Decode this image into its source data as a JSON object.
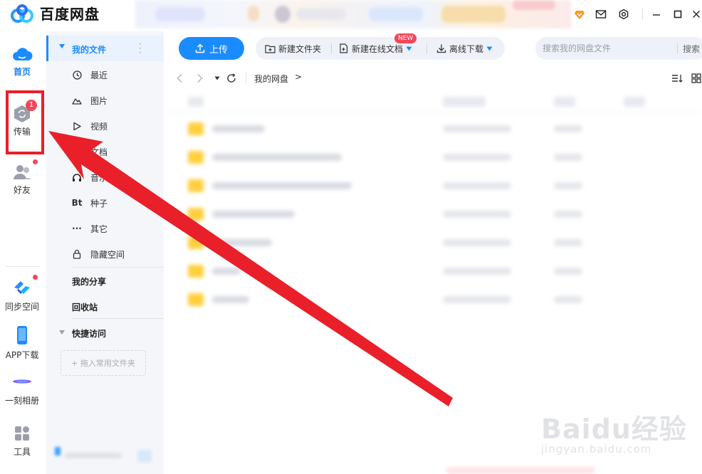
{
  "titlebar": {
    "title": "百度网盘",
    "icons": [
      "app-logo-icon",
      "vip-icon",
      "mail-icon",
      "settings-icon",
      "minimize-icon",
      "maximize-icon",
      "close-icon"
    ]
  },
  "rail": {
    "home": "首页",
    "transfer": "传输",
    "transfer_badge": "1",
    "friends": "好友",
    "sync": "同步空间",
    "app_download": "APP下载",
    "album": "一刻相册",
    "tools": "工具"
  },
  "sidebar": {
    "my_files": "我的文件",
    "items": [
      {
        "label": "最近",
        "icon": "clock-icon"
      },
      {
        "label": "图片",
        "icon": "image-icon"
      },
      {
        "label": "视频",
        "icon": "video-icon"
      },
      {
        "label": "文档",
        "icon": "document-icon"
      },
      {
        "label": "音乐",
        "icon": "headphones-icon"
      },
      {
        "label": "种子",
        "icon": "bt-icon",
        "glyph": "Bt"
      },
      {
        "label": "其它",
        "icon": "more-icon",
        "glyph": "···"
      },
      {
        "label": "隐藏空间",
        "icon": "lock-icon"
      }
    ],
    "my_share": "我的分享",
    "recycle": "回收站",
    "quick_access": "快捷访问",
    "drop_folder": "+ 拖入常用文件夹"
  },
  "toolbar": {
    "upload": "上传",
    "new_folder": "新建文件夹",
    "new_online_doc": "新建在线文档",
    "new_badge": "NEW",
    "offline_download": "离线下载",
    "search_placeholder": "搜索我的网盘文件",
    "search_button": "搜索"
  },
  "navbar": {
    "breadcrumb": "我的网盘",
    "breadcrumb_chevron": ">"
  },
  "watermark": {
    "logo": "Baidu经验",
    "url": "jingyan.baidu.com"
  },
  "colors": {
    "accent": "#1a8cff",
    "annotation_red": "#e91f29",
    "badge_red": "#f5465a",
    "folder_yellow": "#ffcf3d"
  }
}
